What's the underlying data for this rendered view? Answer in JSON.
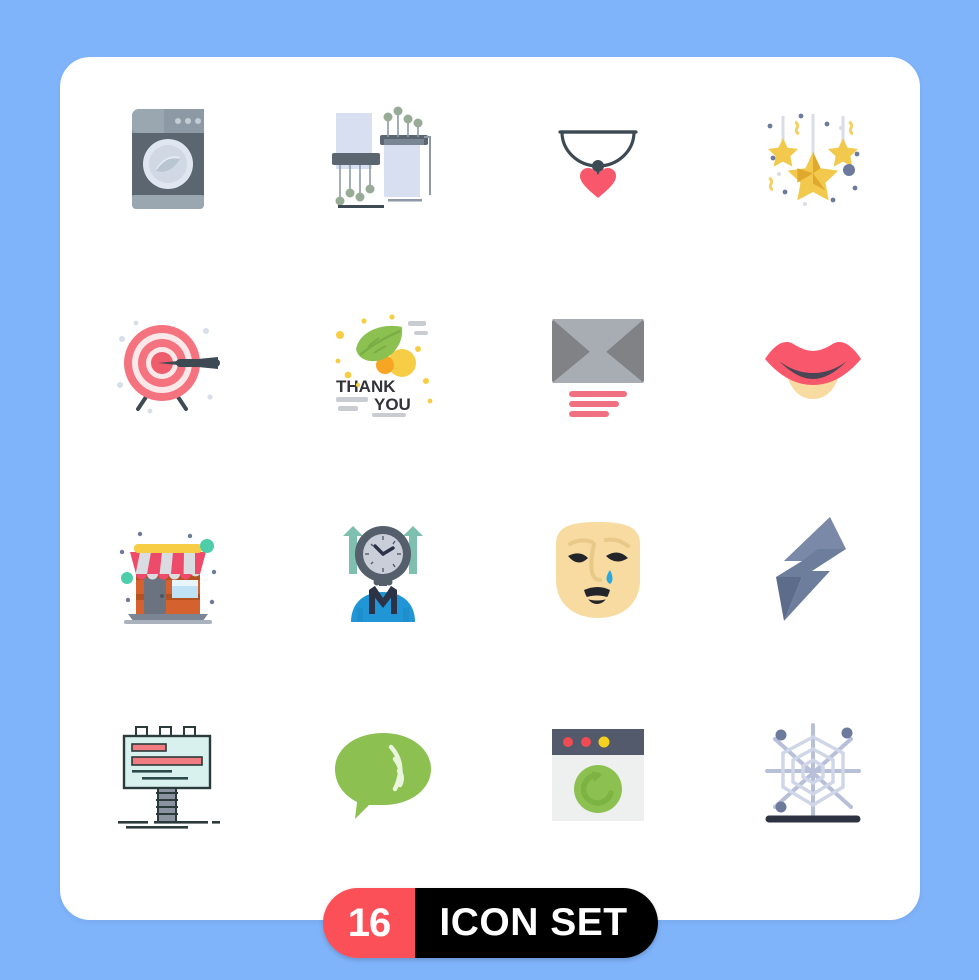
{
  "canvas": {
    "background_color": "#7fb3fa",
    "card_color": "#ffffff"
  },
  "badge": {
    "count": "16",
    "label": "ICON SET",
    "count_bg": "#fb5058",
    "label_bg": "#000000",
    "text_color": "#ffffff"
  },
  "grid": {
    "columns": 4,
    "rows": 4,
    "icons": [
      {
        "name": "washing-machine-icon",
        "label": "Washing machine",
        "colors": {
          "body": "#5b6671",
          "panel": "#8d9aa5",
          "door": "#d6dde6",
          "base": "#9aa7b1"
        }
      },
      {
        "name": "science-lab-equipment-icon",
        "label": "Laboratory equipment",
        "colors": {
          "panel": "#ced5e8",
          "bar": "#5b6671",
          "dot": "#8fa08f"
        }
      },
      {
        "name": "necklace-heart-icon",
        "label": "Necklace with heart pendant",
        "colors": {
          "chain": "#3d4a54",
          "heart": "#f9576b",
          "bead": "#3d4a54"
        }
      },
      {
        "name": "hanging-stars-icon",
        "label": "Hanging stars decoration",
        "colors": {
          "star": "#f2c94c",
          "star_dark": "#e0a92e",
          "string": "#d9dde8",
          "dot": "#6c7a9c"
        }
      },
      {
        "name": "target-arrow-icon",
        "label": "Target with arrow",
        "colors": {
          "ring_outer": "#f4737f",
          "ring_inner": "#ef5c6c",
          "ring_mid": "#f8a5ae",
          "arrow": "#3d4a54"
        }
      },
      {
        "name": "thank-you-card-icon",
        "label": "Thank you card with leaf",
        "text_primary": "THANK",
        "text_secondary": "YOU",
        "colors": {
          "leaf": "#8cc152",
          "leaf_dark": "#7cb342",
          "circle_yellow": "#f7cd46",
          "circle_orange": "#f6a623",
          "text": "#32323a"
        }
      },
      {
        "name": "email-envelope-icon",
        "label": "Email envelope with send lines",
        "colors": {
          "envelope": "#808285",
          "flap": "#a7adb3",
          "lines": "#ef7080"
        }
      },
      {
        "name": "lips-mouth-icon",
        "label": "Lips",
        "colors": {
          "lips": "#f9576b",
          "inner": "#4a4655",
          "chin": "#f7dba0"
        }
      },
      {
        "name": "shop-store-icon",
        "label": "Shop storefront",
        "colors": {
          "awning_top": "#f7cd46",
          "awning_stripe": "#ee4b6a",
          "awning_light": "#d9dde2",
          "wall": "#d4612e",
          "door": "#6b7380",
          "window": "#bfe3f5",
          "base": "#7b8593",
          "dot_green": "#4ecdaa"
        }
      },
      {
        "name": "time-management-person-icon",
        "label": "Person with clock head",
        "colors": {
          "clock_rim": "#555e6b",
          "clock_face": "#c9ced9",
          "shirt": "#2196d6",
          "collar": "#2c3347",
          "arrow": "#7fbfb0"
        }
      },
      {
        "name": "sad-crying-face-icon",
        "label": "Crying sad face",
        "colors": {
          "face": "#f7dba0",
          "features": "#24242b",
          "tear": "#29a8e0",
          "brow": "#e8c98a"
        }
      },
      {
        "name": "lightning-bolt-icon",
        "label": "Lightning bolt",
        "colors": {
          "bolt": "#6d7d9c",
          "bolt_dark": "#5d6c8a"
        }
      },
      {
        "name": "billboard-sign-icon",
        "label": "Billboard sign",
        "colors": {
          "panel": "#d8f0ee",
          "border": "#2b3a3a",
          "bar_red": "#f07b80",
          "bar_dark": "#2b4a4a",
          "pole": "#8b92a0"
        }
      },
      {
        "name": "chat-signal-bubble-icon",
        "label": "Chat bubble with signal waves",
        "colors": {
          "bubble": "#8cc152",
          "waves": "#eaf5dd"
        }
      },
      {
        "name": "browser-refresh-icon",
        "label": "Browser window with refresh",
        "colors": {
          "titlebar": "#525a6b",
          "body": "#eef0ef",
          "circle": "#8cc152",
          "circle_dark": "#7cb342",
          "dot_red": "#ee4b52",
          "dot_yellow": "#f5d11e"
        }
      },
      {
        "name": "spider-web-network-icon",
        "label": "Spider web network",
        "colors": {
          "web": "#b8c0d9",
          "web_light": "#cfd6e8",
          "dot": "#6c7a9c",
          "ground": "#2d3340"
        }
      }
    ]
  }
}
